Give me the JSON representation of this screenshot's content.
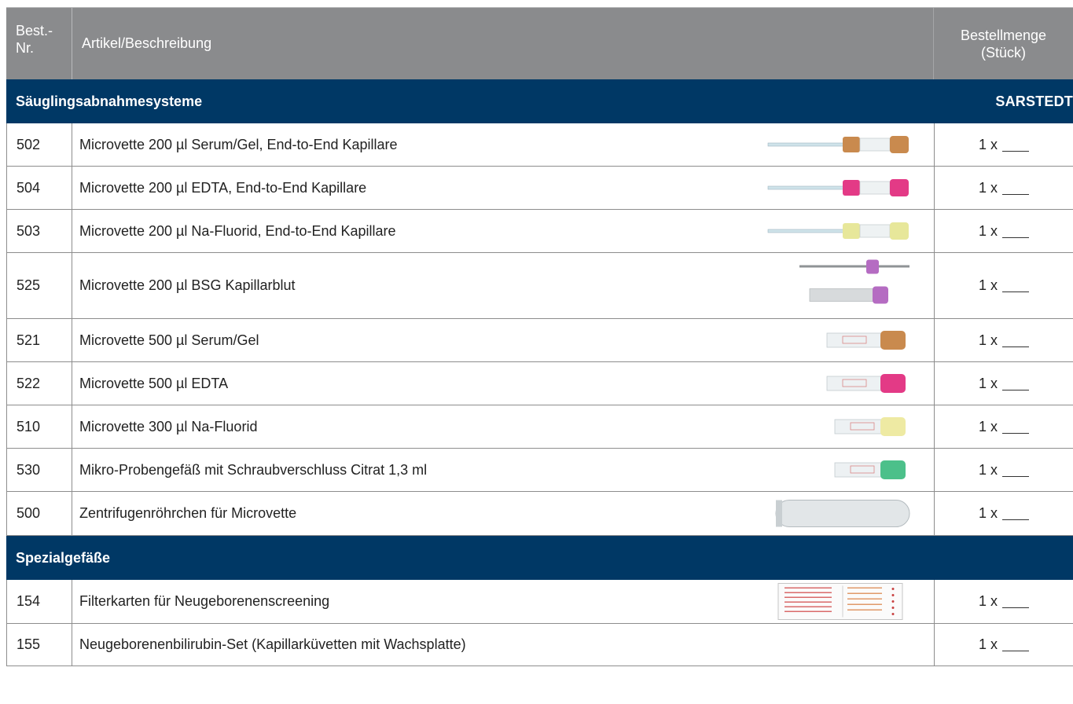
{
  "header": {
    "col_nr": "Best.-\nNr.",
    "col_nr_line1": "Best.-",
    "col_nr_line2": "Nr.",
    "col_desc": "Artikel/Beschreibung",
    "col_qty_line1": "Bestellmenge",
    "col_qty_line2": "(Stück)"
  },
  "sections": [
    {
      "title": "Säuglingsabnahmesysteme",
      "brand": "SARSTEDT",
      "rows": [
        {
          "nr": "502",
          "desc": "Microvette 200 µl Serum/Gel, End-to-End Kapillare",
          "qty": "1 x",
          "image": "microvette-serum-capillary",
          "cap_color": "#c98a4e"
        },
        {
          "nr": "504",
          "desc": "Microvette 200 µl EDTA, End-to-End Kapillare",
          "qty": "1 x",
          "image": "microvette-edta-capillary",
          "cap_color": "#e33a86"
        },
        {
          "nr": "503",
          "desc": "Microvette 200 µl Na-Fluorid, End-to-End Kapillare",
          "qty": "1 x",
          "image": "microvette-fluoride-capillary",
          "cap_color": "#e7e79a"
        },
        {
          "nr": "525",
          "desc": "Microvette 200 µl BSG Kapillarblut",
          "qty": "1 x",
          "image": "microvette-bsg",
          "cap_color": "#b56cc2"
        },
        {
          "nr": "521",
          "desc": "Microvette 500 µl Serum/Gel",
          "qty": "1 x",
          "image": "microvette-500-serum",
          "cap_color": "#c98a4e"
        },
        {
          "nr": "522",
          "desc": "Microvette 500 µl EDTA",
          "qty": "1 x",
          "image": "microvette-500-edta",
          "cap_color": "#e33a86"
        },
        {
          "nr": "510",
          "desc": "Microvette 300 µl Na-Fluorid",
          "qty": "1 x",
          "image": "microvette-300-fluoride",
          "cap_color": "#eeeaa3"
        },
        {
          "nr": "530",
          "desc": "Mikro-Probengefäß mit Schraubverschluss Citrat 1,3 ml",
          "qty": "1 x",
          "image": "micro-tube-citrate",
          "cap_color": "#4cc08a"
        },
        {
          "nr": "500",
          "desc": "Zentrifugenröhrchen für Microvette",
          "qty": "1 x",
          "image": "centrifuge-tube",
          "cap_color": "#d5d8da"
        }
      ]
    },
    {
      "title": "Spezialgefäße",
      "brand": "",
      "rows": [
        {
          "nr": "154",
          "desc": "Filterkarten für Neugeborenenscreening",
          "qty": "1 x",
          "image": "filter-card",
          "cap_color": "#e2e2e2"
        },
        {
          "nr": "155",
          "desc": "Neugeborenenbilirubin-Set (Kapillarküvetten mit Wachsplatte)",
          "qty": "1 x",
          "image": "",
          "cap_color": ""
        }
      ]
    }
  ]
}
